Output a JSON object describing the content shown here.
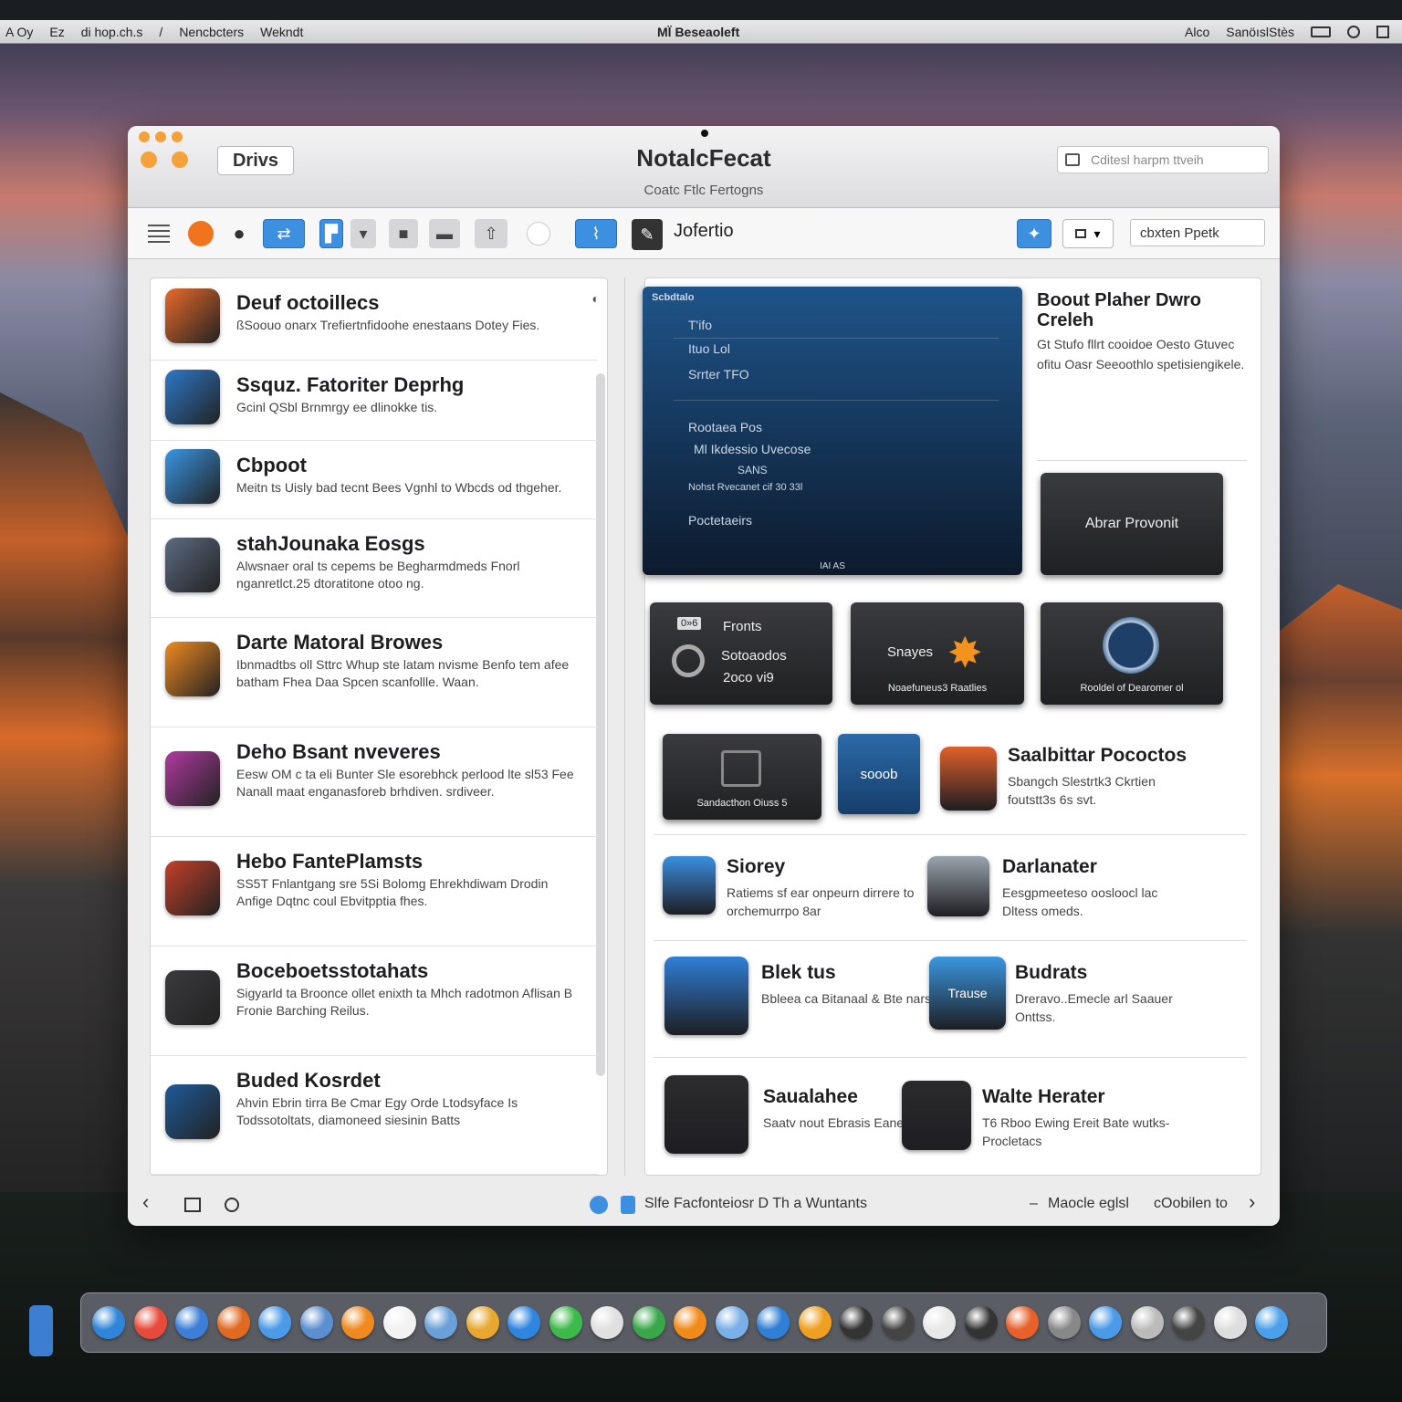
{
  "menubar": {
    "left_items": [
      "A Oy",
      "Ez",
      "di hop.ch.s",
      "/",
      "Nencbcters",
      "Wekndt"
    ],
    "center_title": "Ml̈ Beseaoleft",
    "right_items": [
      "Alco",
      "SanöıslStès"
    ]
  },
  "window": {
    "drives_button": "Drivs",
    "title": "NotalcFecat",
    "subtitle": "Coatc Ftlc Fertogns",
    "search_placeholder": "Cditesl harpm ttveih"
  },
  "toolbar": {
    "label": "Jofertio",
    "dropdown_value": "▾",
    "input_value": "cbxten Ppetk"
  },
  "list": {
    "items": [
      {
        "title": "Deuf octoillecs",
        "desc": "ßSoouo onarx Trefiertnfidoohe enestaans  Dotey Fies.",
        "icon": "colorful-globe-icon",
        "color": "#e86a2a"
      },
      {
        "title": "Ssquz. Fatoriter Deprhg",
        "desc": "Gcinl QSbl Brnmrgy ee dlinokke  tis.",
        "icon": "camera-icon",
        "color": "#2d78c8"
      },
      {
        "title": "Cbpoot",
        "desc": "Meitn ts Uisly bad tecnt Bees Vgnhl to  Wbcds od thgeher.",
        "icon": "x-code-icon",
        "color": "#3a95e4"
      },
      {
        "title": "stahJounaka Eosgs",
        "desc": "Alwsnaer oral ts cepems be Begharmdmeds  Fnorl nganretlct.25 dtoratitone  otoo ng.",
        "icon": "disk-icon",
        "color": "#5c6b82"
      },
      {
        "title": "Darte Matoral Browes",
        "desc": "Ibnmadtbs oll Sttrc Whup ste latam nvisme  Benfo tem afee batham Fhea Daa Spcen scanfollle.  Waan.",
        "icon": "document-icon",
        "color": "#f08a20"
      },
      {
        "title": "Deho Bsant nveveres",
        "desc": "Eesw OM c ta eli Bunter Sle esorebhck perlood lte  sl53 Fee Nanall maat enganasforeb brhdiven.  srdiveer.",
        "icon": "sparkle-icon",
        "color": "#b03aa0"
      },
      {
        "title": "Hebo FantePlamsts",
        "desc": "SS5T Fnlantgang sre 5Si Bolomg Ehrekhdiwam  Drodin Anfige Dqtnc coul Ebvitpptia fhes.",
        "icon": "bars-text-icon",
        "color": "#c4402a"
      },
      {
        "title": "Boceboetsstotahats",
        "desc": "Sigyarld ta Broonce ollet enixth ta Mhch radotmon  Aflisan B Fronie Barching  Reilus.",
        "icon": "lens-icon",
        "color": "#3b3b3e"
      },
      {
        "title": "Buded Kosrdet",
        "desc": "Ahvin Ebrin tirra Be Cmar Egy Orde Ltodsyface Is  Todssotoltats, diamoneed siesinin Batts",
        "icon": "jay-icon",
        "color": "#1f5a9a"
      }
    ]
  },
  "feature": {
    "header": "Scbdtalo",
    "lines": [
      "T'ifo",
      "Ituo Lol",
      "Srrter TFO",
      "Rootaea Pos",
      "Ml Ikdessio Uvecose",
      "SANS",
      "Nohst Rvecanet  cif 30 33l",
      "Poctetaeirs"
    ],
    "footer": "IAI AS"
  },
  "side_info": {
    "title": "Boout Plaher Dwro Creleh",
    "desc": "Gt Stufo fllrt cooidoe Oesto  Gtuvec ofitu Oasr Seeoothlo  spetisiengikele."
  },
  "tiles": {
    "abrar": "Abrar Provonit",
    "fronts": {
      "badge": "0»6",
      "title": "Fronts",
      "line1": "Sotoaodos",
      "line2": "2oco vi9"
    },
    "snayes": {
      "label": "Snayes",
      "caption": "Noaefuneus3 Raatlies"
    },
    "rooldel": {
      "caption": "Rooldel of Dearomer ol"
    },
    "sandacthon": {
      "caption": "Sandacthon Oiuss 5"
    },
    "sooob": "sooob"
  },
  "apps": [
    {
      "title": "Saalbittar Pococtos",
      "desc": "Sbangch Slestrtk3  Ckrtien foutstt3s 6s svt.",
      "icon": "globe-camera-icon",
      "color": "#e0602a"
    },
    {
      "title": "Siorey",
      "desc": "Ratiems sf ear onpeurn dirrere  to orchemurrpo 8ar",
      "icon": "check-tool-icon",
      "color": "#3a8fe0"
    },
    {
      "title": "Darlanater",
      "desc": "Eesgpmeeteso oosloocl lac  Dltess omeds.",
      "icon": "preview-icon",
      "color": "#9aa3ad"
    },
    {
      "title": "Blek tus",
      "desc": "Bbleea ca Bitanaal &  Bte narse?",
      "icon": "ledger-icon",
      "color": "#2f7fd6"
    },
    {
      "title": "Budrats",
      "desc": "Dreravo..Emecle arl Saauer  Onttss.",
      "icon": "trause-icon",
      "color": "#3a98e0",
      "icon_label": "Trause"
    },
    {
      "title": "Saualahee",
      "desc": "Saatv nout Ebrasis  Eanea hn.",
      "icon": "orange-puzzle-icon",
      "color": "#2c2c2e"
    },
    {
      "title": "Walte Herater",
      "desc": "T6 Rboo Ewing Ereit Bate  wutks-Procletacs",
      "icon": "dark-lens-icon",
      "color": "#2b2b2d"
    }
  ],
  "bottombar": {
    "center_text": "Slfe Facfonteiosr D  Th a Wuntants",
    "right_text1": "Maocle eglsl",
    "right_text2": "cOobilen to"
  },
  "dock": {
    "icons": [
      "#2f86d8",
      "#e84a3a",
      "#3d7fd8",
      "#e06a20",
      "#4a9ae8",
      "#5c8fd0",
      "#f08a20",
      "#f2f2f2",
      "#6aa0d8",
      "#e8a830",
      "#2f86e0",
      "#3cba4a",
      "#e0e0e0",
      "#3aa84a",
      "#f28a1a",
      "#7ab0e8",
      "#2f7fd6",
      "#f0a020",
      "#333333",
      "#444444",
      "#e8e8e8",
      "#333333",
      "#e8602a",
      "#888888",
      "#4a9ae8",
      "#bbbbbb",
      "#444444",
      "#dddddd",
      "#4aa0ea"
    ]
  },
  "colors": {
    "accent_blue": "#3d8fe0",
    "traffic_orange": "#f5a23c"
  }
}
